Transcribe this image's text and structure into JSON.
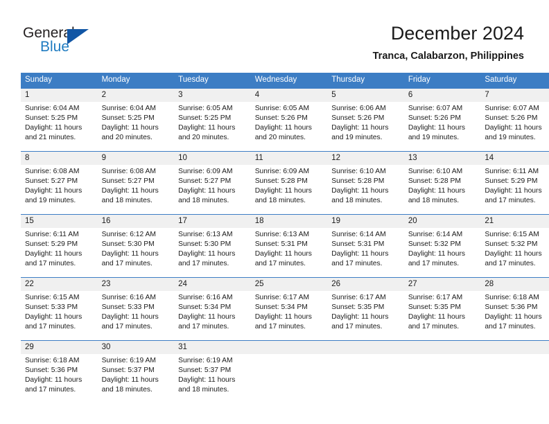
{
  "logo": {
    "word_primary": "General",
    "word_secondary": "Blue",
    "triangle_color": "#1156a5",
    "secondary_color": "#1f7bc1"
  },
  "header": {
    "title": "December 2024",
    "subtitle": "Tranca, Calabarzon, Philippines"
  },
  "theme": {
    "header_row_bg": "#3c7dc4",
    "daynum_bg": "#f0f0f0",
    "grid_line": "#3c7dc4",
    "text": "#1a1a1a"
  },
  "weekdays": [
    "Sunday",
    "Monday",
    "Tuesday",
    "Wednesday",
    "Thursday",
    "Friday",
    "Saturday"
  ],
  "weeks": [
    [
      {
        "day": "1",
        "sunrise": "Sunrise: 6:04 AM",
        "sunset": "Sunset: 5:25 PM",
        "daylight_1": "Daylight: 11 hours",
        "daylight_2": "and 21 minutes."
      },
      {
        "day": "2",
        "sunrise": "Sunrise: 6:04 AM",
        "sunset": "Sunset: 5:25 PM",
        "daylight_1": "Daylight: 11 hours",
        "daylight_2": "and 20 minutes."
      },
      {
        "day": "3",
        "sunrise": "Sunrise: 6:05 AM",
        "sunset": "Sunset: 5:25 PM",
        "daylight_1": "Daylight: 11 hours",
        "daylight_2": "and 20 minutes."
      },
      {
        "day": "4",
        "sunrise": "Sunrise: 6:05 AM",
        "sunset": "Sunset: 5:26 PM",
        "daylight_1": "Daylight: 11 hours",
        "daylight_2": "and 20 minutes."
      },
      {
        "day": "5",
        "sunrise": "Sunrise: 6:06 AM",
        "sunset": "Sunset: 5:26 PM",
        "daylight_1": "Daylight: 11 hours",
        "daylight_2": "and 19 minutes."
      },
      {
        "day": "6",
        "sunrise": "Sunrise: 6:07 AM",
        "sunset": "Sunset: 5:26 PM",
        "daylight_1": "Daylight: 11 hours",
        "daylight_2": "and 19 minutes."
      },
      {
        "day": "7",
        "sunrise": "Sunrise: 6:07 AM",
        "sunset": "Sunset: 5:26 PM",
        "daylight_1": "Daylight: 11 hours",
        "daylight_2": "and 19 minutes."
      }
    ],
    [
      {
        "day": "8",
        "sunrise": "Sunrise: 6:08 AM",
        "sunset": "Sunset: 5:27 PM",
        "daylight_1": "Daylight: 11 hours",
        "daylight_2": "and 19 minutes."
      },
      {
        "day": "9",
        "sunrise": "Sunrise: 6:08 AM",
        "sunset": "Sunset: 5:27 PM",
        "daylight_1": "Daylight: 11 hours",
        "daylight_2": "and 18 minutes."
      },
      {
        "day": "10",
        "sunrise": "Sunrise: 6:09 AM",
        "sunset": "Sunset: 5:27 PM",
        "daylight_1": "Daylight: 11 hours",
        "daylight_2": "and 18 minutes."
      },
      {
        "day": "11",
        "sunrise": "Sunrise: 6:09 AM",
        "sunset": "Sunset: 5:28 PM",
        "daylight_1": "Daylight: 11 hours",
        "daylight_2": "and 18 minutes."
      },
      {
        "day": "12",
        "sunrise": "Sunrise: 6:10 AM",
        "sunset": "Sunset: 5:28 PM",
        "daylight_1": "Daylight: 11 hours",
        "daylight_2": "and 18 minutes."
      },
      {
        "day": "13",
        "sunrise": "Sunrise: 6:10 AM",
        "sunset": "Sunset: 5:28 PM",
        "daylight_1": "Daylight: 11 hours",
        "daylight_2": "and 18 minutes."
      },
      {
        "day": "14",
        "sunrise": "Sunrise: 6:11 AM",
        "sunset": "Sunset: 5:29 PM",
        "daylight_1": "Daylight: 11 hours",
        "daylight_2": "and 17 minutes."
      }
    ],
    [
      {
        "day": "15",
        "sunrise": "Sunrise: 6:11 AM",
        "sunset": "Sunset: 5:29 PM",
        "daylight_1": "Daylight: 11 hours",
        "daylight_2": "and 17 minutes."
      },
      {
        "day": "16",
        "sunrise": "Sunrise: 6:12 AM",
        "sunset": "Sunset: 5:30 PM",
        "daylight_1": "Daylight: 11 hours",
        "daylight_2": "and 17 minutes."
      },
      {
        "day": "17",
        "sunrise": "Sunrise: 6:13 AM",
        "sunset": "Sunset: 5:30 PM",
        "daylight_1": "Daylight: 11 hours",
        "daylight_2": "and 17 minutes."
      },
      {
        "day": "18",
        "sunrise": "Sunrise: 6:13 AM",
        "sunset": "Sunset: 5:31 PM",
        "daylight_1": "Daylight: 11 hours",
        "daylight_2": "and 17 minutes."
      },
      {
        "day": "19",
        "sunrise": "Sunrise: 6:14 AM",
        "sunset": "Sunset: 5:31 PM",
        "daylight_1": "Daylight: 11 hours",
        "daylight_2": "and 17 minutes."
      },
      {
        "day": "20",
        "sunrise": "Sunrise: 6:14 AM",
        "sunset": "Sunset: 5:32 PM",
        "daylight_1": "Daylight: 11 hours",
        "daylight_2": "and 17 minutes."
      },
      {
        "day": "21",
        "sunrise": "Sunrise: 6:15 AM",
        "sunset": "Sunset: 5:32 PM",
        "daylight_1": "Daylight: 11 hours",
        "daylight_2": "and 17 minutes."
      }
    ],
    [
      {
        "day": "22",
        "sunrise": "Sunrise: 6:15 AM",
        "sunset": "Sunset: 5:33 PM",
        "daylight_1": "Daylight: 11 hours",
        "daylight_2": "and 17 minutes."
      },
      {
        "day": "23",
        "sunrise": "Sunrise: 6:16 AM",
        "sunset": "Sunset: 5:33 PM",
        "daylight_1": "Daylight: 11 hours",
        "daylight_2": "and 17 minutes."
      },
      {
        "day": "24",
        "sunrise": "Sunrise: 6:16 AM",
        "sunset": "Sunset: 5:34 PM",
        "daylight_1": "Daylight: 11 hours",
        "daylight_2": "and 17 minutes."
      },
      {
        "day": "25",
        "sunrise": "Sunrise: 6:17 AM",
        "sunset": "Sunset: 5:34 PM",
        "daylight_1": "Daylight: 11 hours",
        "daylight_2": "and 17 minutes."
      },
      {
        "day": "26",
        "sunrise": "Sunrise: 6:17 AM",
        "sunset": "Sunset: 5:35 PM",
        "daylight_1": "Daylight: 11 hours",
        "daylight_2": "and 17 minutes."
      },
      {
        "day": "27",
        "sunrise": "Sunrise: 6:17 AM",
        "sunset": "Sunset: 5:35 PM",
        "daylight_1": "Daylight: 11 hours",
        "daylight_2": "and 17 minutes."
      },
      {
        "day": "28",
        "sunrise": "Sunrise: 6:18 AM",
        "sunset": "Sunset: 5:36 PM",
        "daylight_1": "Daylight: 11 hours",
        "daylight_2": "and 17 minutes."
      }
    ],
    [
      {
        "day": "29",
        "sunrise": "Sunrise: 6:18 AM",
        "sunset": "Sunset: 5:36 PM",
        "daylight_1": "Daylight: 11 hours",
        "daylight_2": "and 17 minutes."
      },
      {
        "day": "30",
        "sunrise": "Sunrise: 6:19 AM",
        "sunset": "Sunset: 5:37 PM",
        "daylight_1": "Daylight: 11 hours",
        "daylight_2": "and 18 minutes."
      },
      {
        "day": "31",
        "sunrise": "Sunrise: 6:19 AM",
        "sunset": "Sunset: 5:37 PM",
        "daylight_1": "Daylight: 11 hours",
        "daylight_2": "and 18 minutes."
      },
      null,
      null,
      null,
      null
    ]
  ]
}
